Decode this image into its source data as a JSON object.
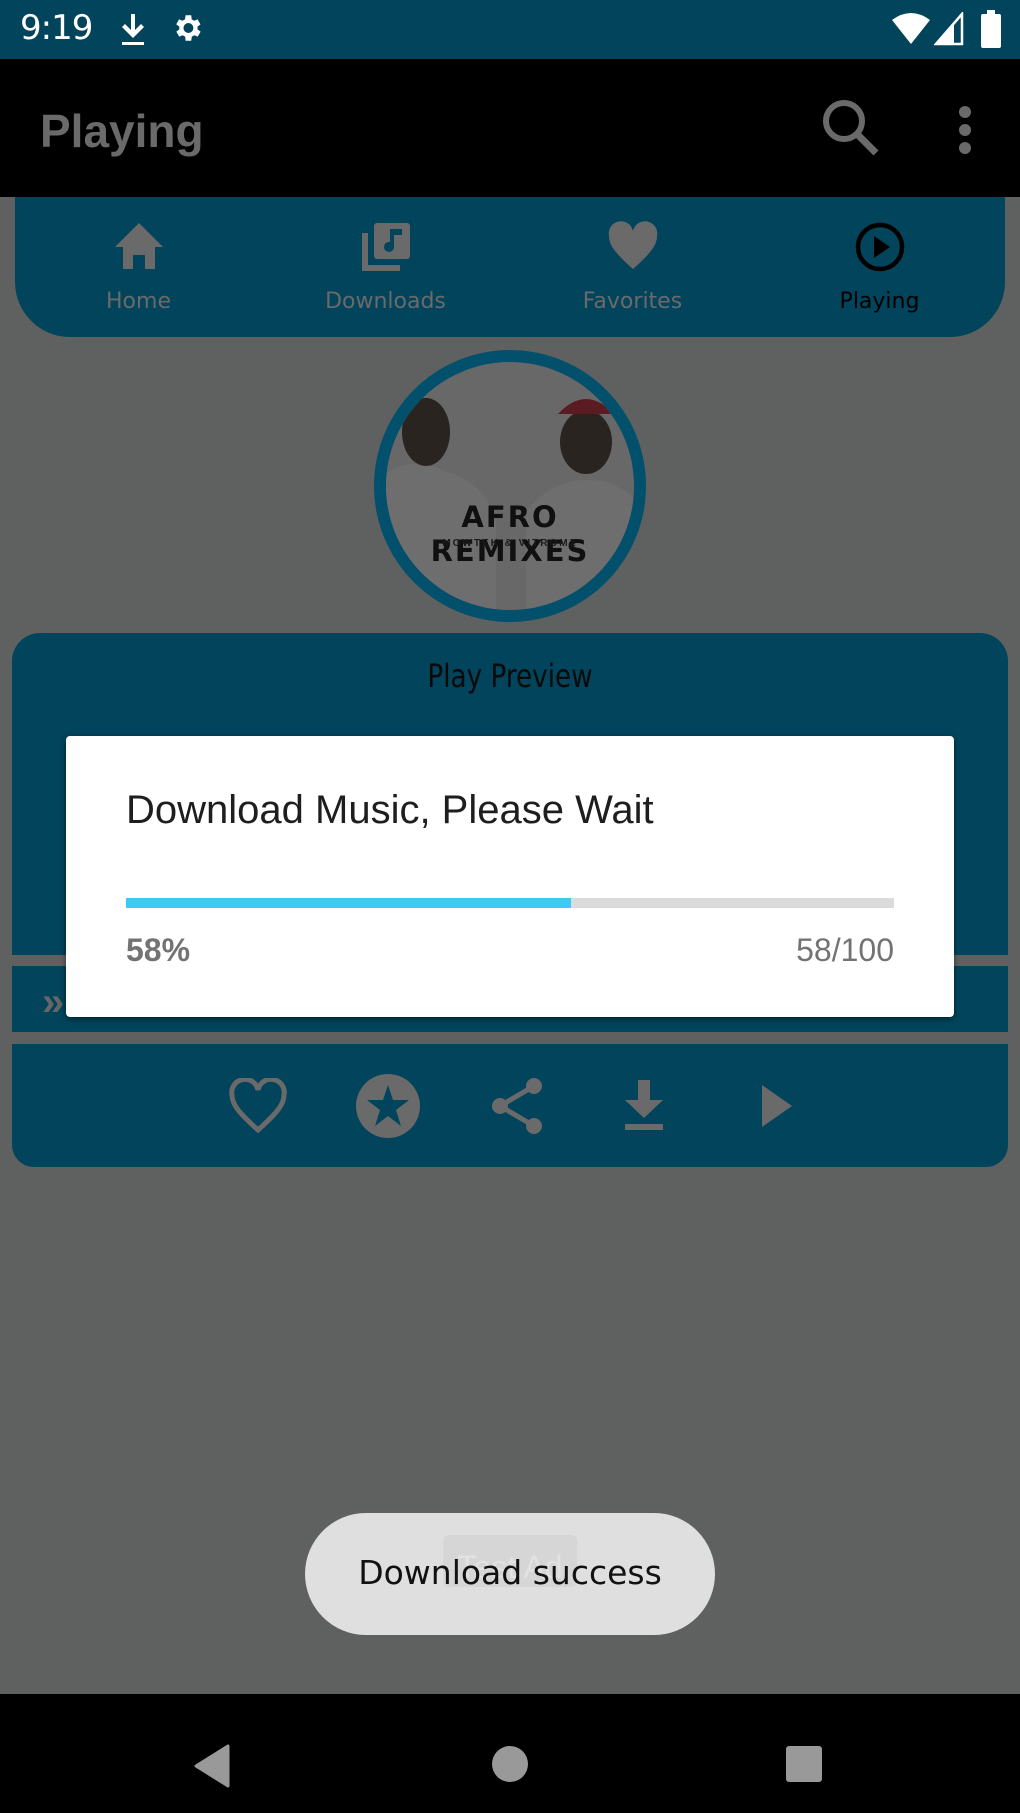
{
  "status_bar": {
    "time": "9:19",
    "left_icons": [
      "download-icon",
      "settings-icon"
    ],
    "right_icons": [
      "wifi-icon",
      "signal-icon",
      "battery-icon"
    ]
  },
  "app_bar": {
    "title": "Playing",
    "actions": [
      "search-icon",
      "more-vert-icon"
    ]
  },
  "top_nav": {
    "items": [
      {
        "label": "Home",
        "icon": "home-icon",
        "active": false
      },
      {
        "label": "Downloads",
        "icon": "library-music-icon",
        "active": false
      },
      {
        "label": "Favorites",
        "icon": "heart-icon",
        "active": false
      },
      {
        "label": "Playing",
        "icon": "play-circle-icon",
        "active": true
      }
    ]
  },
  "album": {
    "title": "AFRO REMIXES",
    "subtitle": "MOWTEK & VITROMZ"
  },
  "player": {
    "preview_label": "Play Preview",
    "seek_icon": "fast-forward-chevron-icon",
    "controls": [
      "favorite-outline-icon",
      "star-circle-icon",
      "share-icon",
      "download-icon",
      "play-icon"
    ]
  },
  "dialog": {
    "title": "Download Music, Please Wait",
    "progress_percent": 58,
    "progress_label": "58%",
    "progress_count": "58/100"
  },
  "toast": {
    "message": "Download success",
    "background_ad_label": "Test Ad"
  },
  "colors": {
    "primary": "#02445b",
    "progress": "#3fc8f4",
    "track": "#dbdbdb",
    "scrim": "#5f6160"
  }
}
